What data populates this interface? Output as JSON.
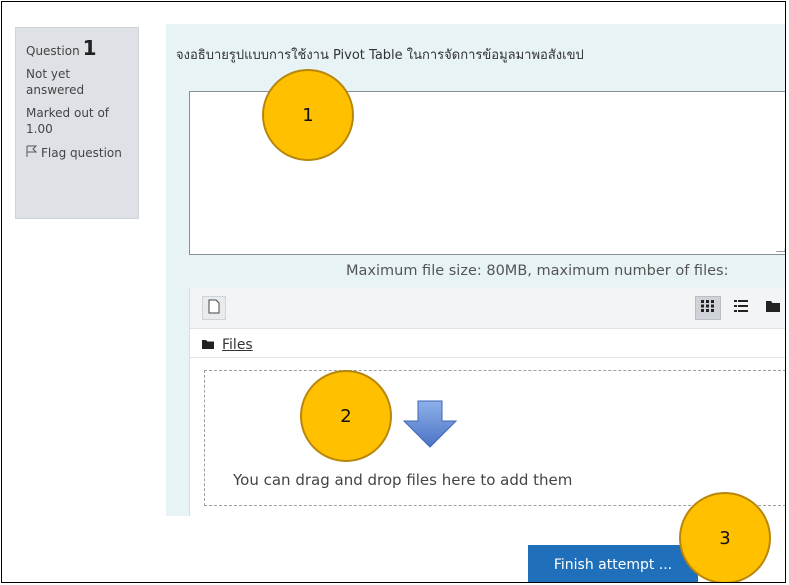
{
  "question_info": {
    "label": "Question",
    "number": "1",
    "status": "Not yet answered",
    "marked": "Marked out of 1.00",
    "flag": "Flag question"
  },
  "question": {
    "text": "จงอธิบายรูปแบบการใช้งาน Pivot Table ในการจัดการข้อมูลมาพอสังเขป",
    "answer_value": ""
  },
  "file_limits": "Maximum file size: 80MB, maximum number of files:",
  "file_manager": {
    "path_label": "Files",
    "drop_hint": "You can drag and drop files here to add them",
    "icons": {
      "add": "file-icon",
      "view_icons": "grid-icon",
      "view_list": "list-icon",
      "view_tree": "folder-icon"
    }
  },
  "finish_button": "Finish attempt ...",
  "callouts": [
    "1",
    "2",
    "3"
  ],
  "colors": {
    "callout": "#ffc000",
    "question_bg": "#e7f3f5",
    "finish_button": "#1f6fba",
    "info_panel": "#dee2e6",
    "arrow": "#5b86d4"
  }
}
